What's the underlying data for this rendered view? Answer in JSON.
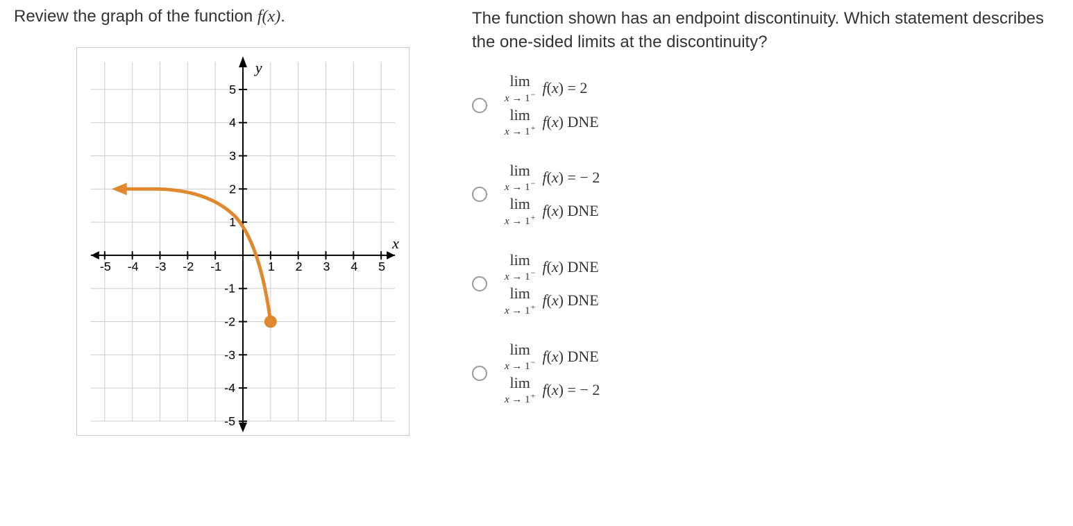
{
  "left": {
    "instruction_pre": "Review the graph of the function ",
    "instruction_fx": "f(x)",
    "instruction_post": "."
  },
  "right": {
    "question": "The function shown has an endpoint discontinuity. Which statement describes the one-sided limits at the discontinuity?"
  },
  "options": {
    "a": {
      "left1": "lim",
      "sub1": "x → 1⁻",
      "right1": "f(x) = 2",
      "left2": "lim",
      "sub2": "x → 1⁺",
      "right2": "f(x) DNE"
    },
    "b": {
      "left1": "lim",
      "sub1": "x → 1⁻",
      "right1": "f(x) = − 2",
      "left2": "lim",
      "sub2": "x → 1⁺",
      "right2": "f(x) DNE"
    },
    "c": {
      "left1": "lim",
      "sub1": "x → 1⁻",
      "right1": "f(x) DNE",
      "left2": "lim",
      "sub2": "x → 1⁺",
      "right2": "f(x) DNE"
    },
    "d": {
      "left1": "lim",
      "sub1": "x → 1⁻",
      "right1": "f(x) DNE",
      "left2": "lim",
      "sub2": "x → 1⁺",
      "right2": "f(x) = − 2"
    }
  },
  "chart_data": {
    "type": "line",
    "title": "",
    "xlabel": "x",
    "ylabel": "y",
    "xlim": [
      -5.5,
      5.5
    ],
    "ylim": [
      -5.5,
      5.5
    ],
    "x_ticks": [
      -5,
      -4,
      -3,
      -2,
      -1,
      1,
      2,
      3,
      4,
      5
    ],
    "y_ticks": [
      -5,
      -4,
      -3,
      -2,
      -1,
      1,
      2,
      3,
      4,
      5
    ],
    "series": [
      {
        "name": "f(x)",
        "color": "#e0892f",
        "points": [
          {
            "x": -5,
            "y": 2
          },
          {
            "x": -4,
            "y": 2
          },
          {
            "x": -3,
            "y": 2
          },
          {
            "x": -2,
            "y": 2
          },
          {
            "x": -1,
            "y": 1.9
          },
          {
            "x": 0,
            "y": 1
          },
          {
            "x": 0.5,
            "y": 0
          },
          {
            "x": 0.8,
            "y": -1
          },
          {
            "x": 1,
            "y": -2
          }
        ],
        "endpoint": {
          "x": 1,
          "y": -2,
          "filled": true
        },
        "arrow_left": true
      }
    ]
  }
}
